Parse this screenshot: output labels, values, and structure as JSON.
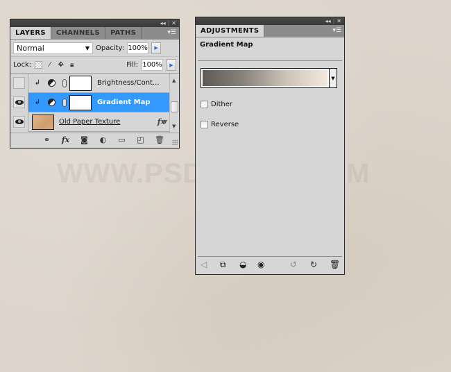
{
  "watermark": "WWW.PSD-DUDE.COM",
  "layers_panel": {
    "tabs": [
      {
        "label": "LAYERS",
        "active": true
      },
      {
        "label": "CHANNELS",
        "active": false
      },
      {
        "label": "PATHS",
        "active": false
      }
    ],
    "blend_mode": "Normal",
    "opacity_label": "Opacity:",
    "opacity_value": "100%",
    "lock_label": "Lock:",
    "fill_label": "Fill:",
    "fill_value": "100%",
    "layers": [
      {
        "name": "Brightness/Cont...",
        "visible": false,
        "selected": false,
        "type": "adjustment"
      },
      {
        "name": "Gradient Map",
        "visible": true,
        "selected": true,
        "type": "adjustment"
      },
      {
        "name": "Old Paper Texture",
        "visible": true,
        "selected": false,
        "type": "image",
        "fx": "fx"
      }
    ],
    "bottom_icons": [
      "link-icon",
      "fx-icon",
      "mask-icon",
      "adjustment-icon",
      "folder-icon",
      "new-layer-icon",
      "trash-icon"
    ],
    "bottom_fx": "fx"
  },
  "adjustments_panel": {
    "tab": "ADJUSTMENTS",
    "title": "Gradient Map",
    "gradient_colors": [
      "#5f5a55",
      "#8a847d",
      "#cdc3b8",
      "#f3e8de"
    ],
    "dither_label": "Dither",
    "dither_checked": false,
    "reverse_label": "Reverse",
    "reverse_checked": false,
    "bottom_icons": [
      "back-icon",
      "expand-icon",
      "clip-icon",
      "visibility-icon",
      "previous-state-icon",
      "reset-icon",
      "trash-icon"
    ]
  },
  "colors": {
    "selection": "#3399ff",
    "panel_bg": "#d6d6d6",
    "canvas_bg": "#ddd5cb"
  }
}
